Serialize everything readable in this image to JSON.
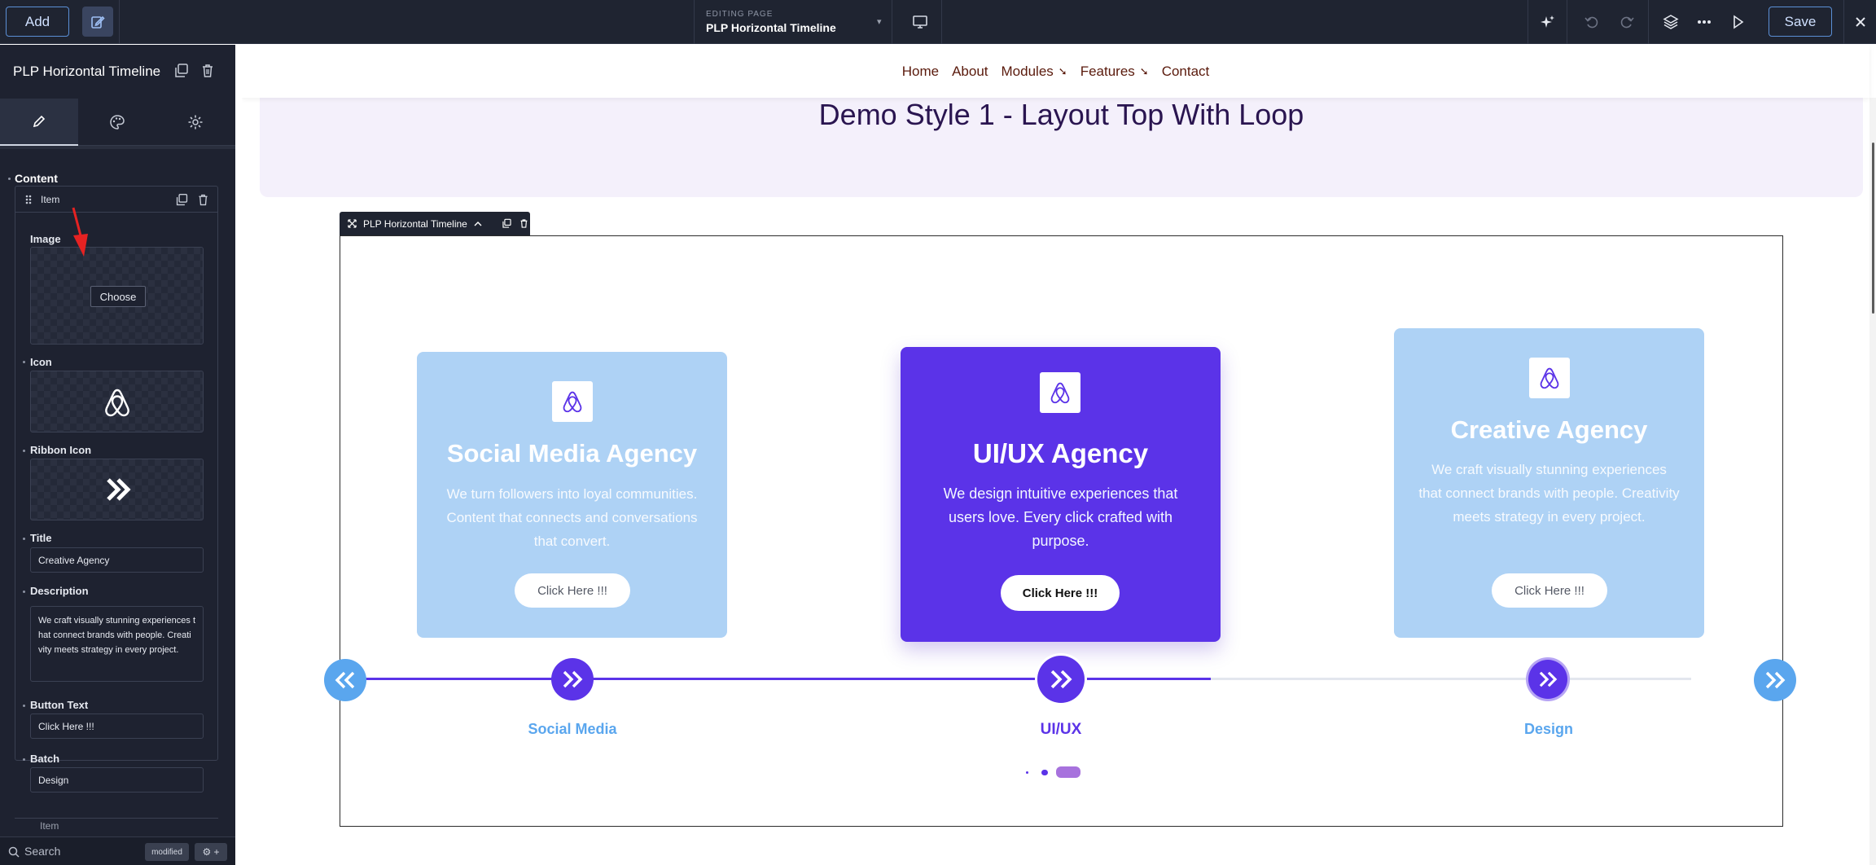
{
  "topbar": {
    "add_label": "Add",
    "editing_caption": "EDITING PAGE",
    "page_name": "PLP Horizontal Timeline",
    "save_label": "Save",
    "icons": [
      "edit-icon",
      "chevron-down-icon",
      "desktop-icon",
      "ai-sparkle-icon",
      "undo-icon",
      "redo-icon",
      "layers-icon",
      "more-icon",
      "play-icon",
      "close-icon"
    ]
  },
  "panel": {
    "title": "PLP Horizontal Timeline",
    "tabs": [
      "content-tab",
      "style-tab",
      "settings-tab"
    ],
    "section_label": "Content",
    "item_label": "Item",
    "next_item_label": "Item",
    "fields": {
      "image_label": "Image",
      "choose_label": "Choose",
      "icon_label": "Icon",
      "ribbon_icon_label": "Ribbon Icon",
      "title_label": "Title",
      "title_value": "Creative Agency",
      "description_label": "Description",
      "description_value": "We craft visually stunning experiences that connect brands with people. Creativity meets strategy in every project.",
      "button_text_label": "Button Text",
      "button_text_value": "Click Here !!!",
      "batch_label": "Batch",
      "batch_value": "Design"
    },
    "footer": {
      "search_label": "Search",
      "modified_badge": "modified",
      "gear_badge": "⚙ +"
    }
  },
  "site": {
    "nav": [
      {
        "label": "Home",
        "has_arrow": false
      },
      {
        "label": "About",
        "has_arrow": false
      },
      {
        "label": "Modules",
        "has_arrow": true
      },
      {
        "label": "Features",
        "has_arrow": true
      },
      {
        "label": "Contact",
        "has_arrow": false
      }
    ],
    "nav_arrow": "➘",
    "demo_title": "Demo Style 1 - Layout Top With Loop",
    "widget_tag": "PLP Horizontal Timeline"
  },
  "timeline": {
    "cards": [
      {
        "title": "Social Media Agency",
        "description": "We turn followers into loyal communities. Content that connects and conversations that convert.",
        "button": "Click Here !!!",
        "batch": "Social Media",
        "active": false
      },
      {
        "title": "UI/UX Agency",
        "description": "We design intuitive experiences that users love. Every click crafted with purpose.",
        "button": "Click Here !!!",
        "batch": "UI/UX",
        "active": true
      },
      {
        "title": "Creative Agency",
        "description": "We craft visually stunning experiences that connect brands with people. Creativity meets strategy in every project.",
        "button": "Click Here !!!",
        "batch": "Design",
        "active": false
      }
    ],
    "pager_active_index": 2,
    "colors": {
      "accent": "#5b33e8",
      "side_card": "#aed2f5",
      "nav_arrow_bg": "#5aa6ee",
      "label_blue": "#5aa6ee",
      "label_active": "#5b33e8"
    }
  }
}
